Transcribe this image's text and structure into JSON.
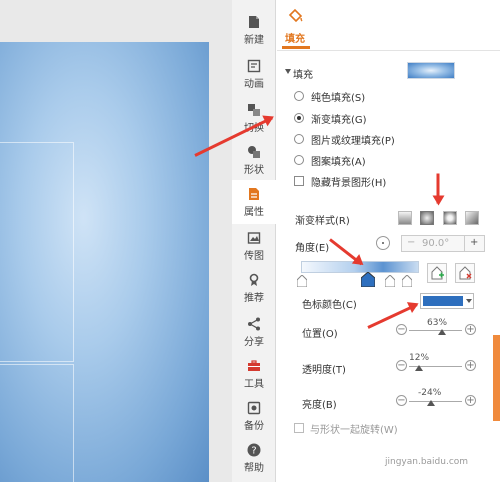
{
  "rail": {
    "items": [
      {
        "label": "新建",
        "icon": "file-icon"
      },
      {
        "label": "动画",
        "icon": "animation-icon"
      },
      {
        "label": "切换",
        "icon": "transition-icon"
      },
      {
        "label": "形状",
        "icon": "shape-icon"
      },
      {
        "label": "属性",
        "icon": "properties-icon",
        "active": true
      },
      {
        "label": "传图",
        "icon": "image-upload-icon"
      },
      {
        "label": "推荐",
        "icon": "recommend-icon"
      },
      {
        "label": "分享",
        "icon": "share-icon"
      },
      {
        "label": "工具",
        "icon": "toolbox-icon"
      },
      {
        "label": "备份",
        "icon": "backup-icon"
      },
      {
        "label": "帮助",
        "icon": "help-icon"
      }
    ]
  },
  "panel": {
    "tab_label": "填充",
    "section_title": "填充",
    "fill_options": {
      "solid": "纯色填充(S)",
      "gradient": "渐变填充(G)",
      "picture": "图片或纹理填充(P)",
      "pattern": "图案填充(A)",
      "selected": "gradient"
    },
    "hide_background": "隐藏背景图形(H)",
    "gradient_style_label": "渐变样式(R)",
    "angle_label": "角度(E)",
    "angle_value": "90.0°",
    "angle_minus": "−",
    "angle_plus": "+",
    "stop_color_label": "色标颜色(C)",
    "stop_color": "#2e6fbe",
    "position_label": "位置(O)",
    "position_value": "63%",
    "transparency_label": "透明度(T)",
    "transparency_value": "12%",
    "brightness_label": "亮度(B)",
    "brightness_value": "-24%",
    "rotate_with_shape": "与形状一起旋转(W)",
    "slider_minus": "−",
    "slider_plus": "+"
  },
  "colors": {
    "accent": "#e2771f",
    "annotation_arrow": "#e53a2f",
    "gradient_preview": "#2e6fbe"
  },
  "watermark": "jingyan.baidu.com"
}
